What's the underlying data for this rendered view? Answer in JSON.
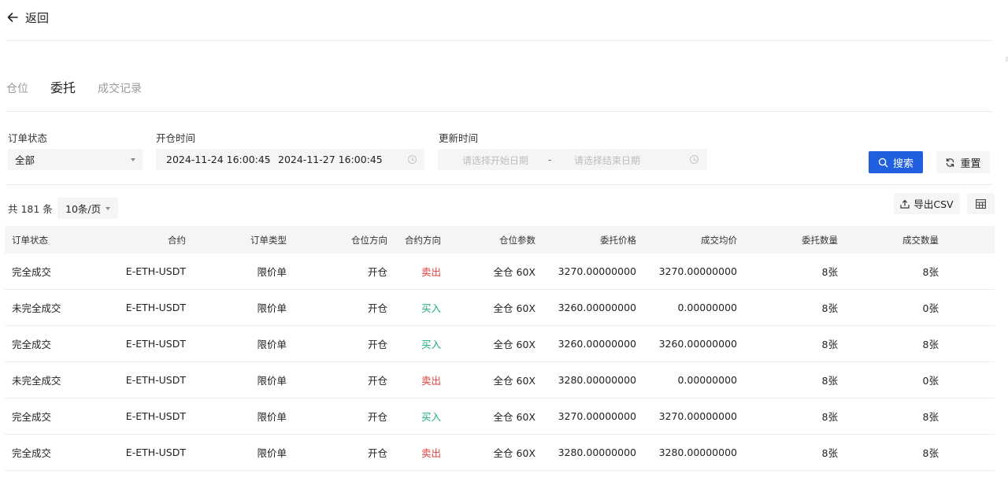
{
  "header": {
    "back_label": "返回"
  },
  "tabs": [
    {
      "label": "仓位",
      "active": false
    },
    {
      "label": "委托",
      "active": true
    },
    {
      "label": "成交记录",
      "active": false
    }
  ],
  "filters": {
    "status": {
      "label": "订单状态",
      "value": "全部"
    },
    "open_time": {
      "label": "开仓时间",
      "start": "2024-11-24 16:00:45",
      "separator": "-",
      "end": "2024-11-27 16:00:45"
    },
    "update_time": {
      "label": "更新时间",
      "start_placeholder": "请选择开始日期",
      "separator": "-",
      "end_placeholder": "请选择结束日期"
    },
    "search_label": "搜索",
    "reset_label": "重置"
  },
  "toolbar": {
    "total_text": "共 181 条",
    "page_size": "10条/页",
    "export_label": "导出CSV"
  },
  "colors": {
    "accent": "#1f5fe0",
    "sell": "#e0403f",
    "buy": "#1fae7e"
  },
  "table": {
    "columns": [
      "订单状态",
      "合约",
      "订单类型",
      "仓位方向",
      "合约方向",
      "仓位参数",
      "委托价格",
      "成交均价",
      "委托数量",
      "成交数量"
    ],
    "rows": [
      {
        "status": "完全成交",
        "contract": "E-ETH-USDT",
        "order_type": "限价单",
        "position_side": "开仓",
        "side": "卖出",
        "side_type": "sell",
        "params": "全仓 60X",
        "price": "3270.00000000",
        "avg_price": "3270.00000000",
        "qty": "8张",
        "filled_qty": "8张"
      },
      {
        "status": "未完全成交",
        "contract": "E-ETH-USDT",
        "order_type": "限价单",
        "position_side": "开仓",
        "side": "买入",
        "side_type": "buy",
        "params": "全仓 60X",
        "price": "3260.00000000",
        "avg_price": "0.00000000",
        "qty": "8张",
        "filled_qty": "0张"
      },
      {
        "status": "完全成交",
        "contract": "E-ETH-USDT",
        "order_type": "限价单",
        "position_side": "开仓",
        "side": "买入",
        "side_type": "buy",
        "params": "全仓 60X",
        "price": "3260.00000000",
        "avg_price": "3260.00000000",
        "qty": "8张",
        "filled_qty": "8张"
      },
      {
        "status": "未完全成交",
        "contract": "E-ETH-USDT",
        "order_type": "限价单",
        "position_side": "开仓",
        "side": "卖出",
        "side_type": "sell",
        "params": "全仓 60X",
        "price": "3280.00000000",
        "avg_price": "0.00000000",
        "qty": "8张",
        "filled_qty": "0张"
      },
      {
        "status": "完全成交",
        "contract": "E-ETH-USDT",
        "order_type": "限价单",
        "position_side": "开仓",
        "side": "买入",
        "side_type": "buy",
        "params": "全仓 60X",
        "price": "3270.00000000",
        "avg_price": "3270.00000000",
        "qty": "8张",
        "filled_qty": "8张"
      },
      {
        "status": "完全成交",
        "contract": "E-ETH-USDT",
        "order_type": "限价单",
        "position_side": "开仓",
        "side": "卖出",
        "side_type": "sell",
        "params": "全仓 60X",
        "price": "3280.00000000",
        "avg_price": "3280.00000000",
        "qty": "8张",
        "filled_qty": "8张"
      }
    ]
  }
}
